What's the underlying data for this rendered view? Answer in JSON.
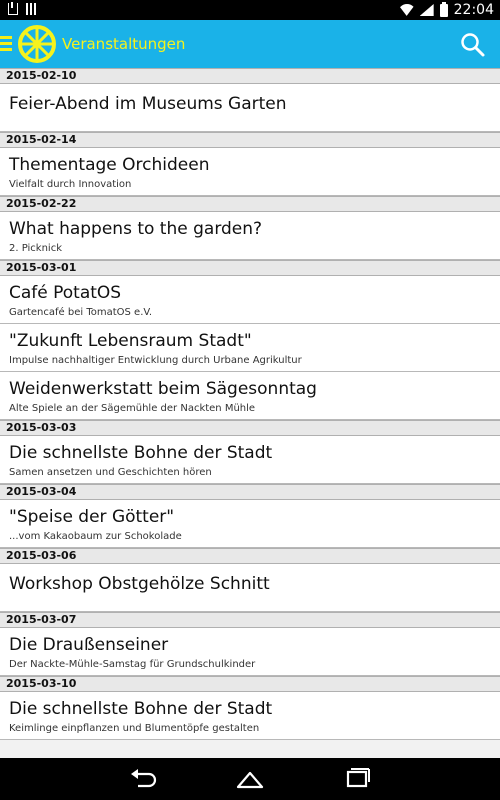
{
  "status_bar": {
    "time": "22:04"
  },
  "app_bar": {
    "title": "Veranstaltungen",
    "icons": [
      "menu-icon",
      "logo-wheel-icon",
      "search-icon"
    ]
  },
  "colors": {
    "accent": "#1ab2e8",
    "title": "#f5f21c"
  },
  "list": [
    {
      "date": "2015-02-10",
      "events": [
        {
          "title": "Feier-Abend im Museums Garten",
          "subtitle": ""
        }
      ]
    },
    {
      "date": "2015-02-14",
      "events": [
        {
          "title": "Thementage Orchideen",
          "subtitle": "Vielfalt durch Innovation"
        }
      ]
    },
    {
      "date": "2015-02-22",
      "events": [
        {
          "title": "What happens to the garden?",
          "subtitle": "2. Picknick"
        }
      ]
    },
    {
      "date": "2015-03-01",
      "events": [
        {
          "title": "Café PotatOS",
          "subtitle": "Gartencafé bei TomatOS e.V."
        },
        {
          "title": "\"Zukunft Lebensraum Stadt\"",
          "subtitle": "Impulse nachhaltiger Entwicklung durch Urbane Agrikultur"
        },
        {
          "title": "Weidenwerkstatt beim Sägesonntag",
          "subtitle": "Alte Spiele an der Sägemühle der Nackten Mühle"
        }
      ]
    },
    {
      "date": "2015-03-03",
      "events": [
        {
          "title": "Die schnellste Bohne der Stadt",
          "subtitle": "Samen ansetzen und Geschichten hören"
        }
      ]
    },
    {
      "date": "2015-03-04",
      "events": [
        {
          "title": "\"Speise der Götter\"",
          "subtitle": "...vom Kakaobaum zur Schokolade"
        }
      ]
    },
    {
      "date": "2015-03-06",
      "events": [
        {
          "title": "Workshop Obstgehölze Schnitt",
          "subtitle": ""
        }
      ]
    },
    {
      "date": "2015-03-07",
      "events": [
        {
          "title": "Die Draußenseiner",
          "subtitle": "Der Nackte-Mühle-Samstag für Grundschulkinder"
        }
      ]
    },
    {
      "date": "2015-03-10",
      "events": [
        {
          "title": "Die schnellste Bohne der Stadt",
          "subtitle": "Keimlinge einpflanzen und Blumentöpfe gestalten"
        }
      ]
    }
  ],
  "nav_bar": {
    "icons": [
      "back-icon",
      "home-icon",
      "recents-icon"
    ]
  }
}
